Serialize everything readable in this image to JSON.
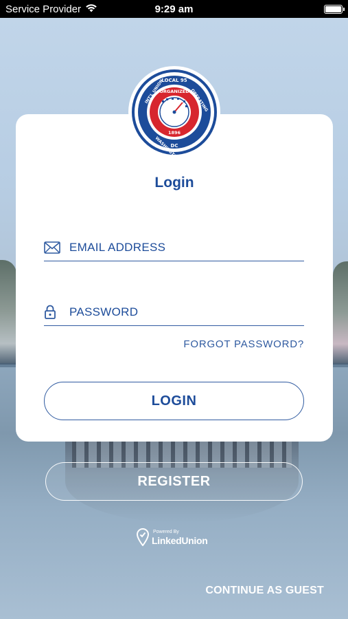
{
  "status_bar": {
    "carrier": "Service Provider",
    "time": "9:29 am",
    "wifi_icon": "wifi-icon",
    "battery_icon": "battery-icon"
  },
  "logo": {
    "top_text": "LOCAL 95",
    "ring_text": "INTERNATIONAL UNION OF OPERATING ENGINEERS",
    "center_text": "ORGANIZED DEC 7 1896",
    "bottom_text": "WASHINGTON",
    "footer_text": "DC"
  },
  "login": {
    "title": "Login",
    "email_placeholder": "EMAIL ADDRESS",
    "password_placeholder": "PASSWORD",
    "forgot_label": "FORGOT PASSWORD?",
    "login_label": "LOGIN"
  },
  "register_label": "REGISTER",
  "powered_by": {
    "small": "Powered By",
    "brand": "LinkedUnion"
  },
  "guest_label": "CONTINUE AS GUEST",
  "colors": {
    "accent": "#1d4c9a",
    "card": "#ffffff"
  }
}
